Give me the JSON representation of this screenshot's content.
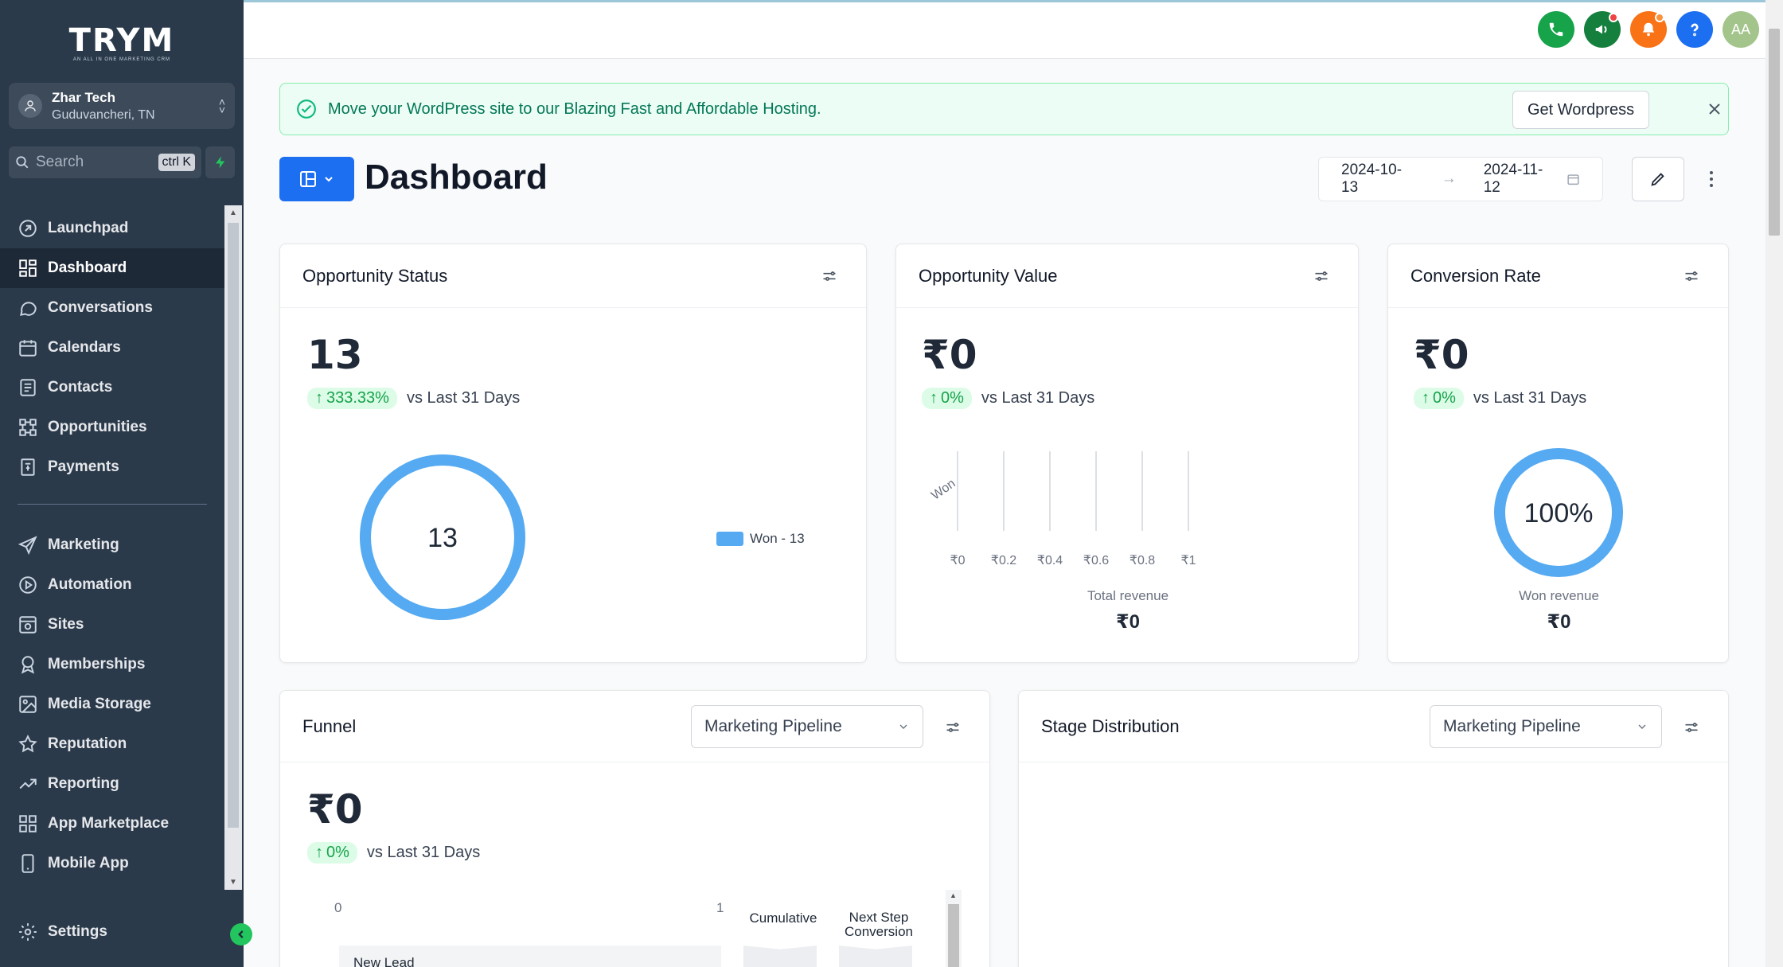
{
  "brand": {
    "logo": "TRYM",
    "tagline": "AN ALL IN ONE MARKETING CRM"
  },
  "account": {
    "name": "Zhar Tech",
    "location": "Guduvancheri, TN"
  },
  "search": {
    "placeholder": "Search",
    "shortcut": "ctrl K"
  },
  "nav": {
    "primary": [
      "Launchpad",
      "Dashboard",
      "Conversations",
      "Calendars",
      "Contacts",
      "Opportunities",
      "Payments"
    ],
    "secondary": [
      "Marketing",
      "Automation",
      "Sites",
      "Memberships",
      "Media Storage",
      "Reputation",
      "Reporting",
      "App Marketplace",
      "Mobile App"
    ],
    "settings": "Settings"
  },
  "topbar": {
    "avatar_initials": "AA"
  },
  "banner": {
    "text": "Move your WordPress site to our Blazing Fast and Affordable Hosting.",
    "button": "Get Wordpress"
  },
  "page": {
    "title": "Dashboard",
    "date_from": "2024-10-13",
    "date_to": "2024-11-12"
  },
  "cards": {
    "opportunity_status": {
      "title": "Opportunity Status",
      "value": "13",
      "change": "333.33%",
      "compare": "vs Last 31 Days",
      "donut_center": "13",
      "legend": "Won - 13",
      "chart_data": {
        "type": "pie",
        "categories": [
          "Won"
        ],
        "values": [
          13
        ]
      }
    },
    "opportunity_value": {
      "title": "Opportunity Value",
      "value": "₹0",
      "change": "0%",
      "compare": "vs Last 31 Days",
      "category_label": "Won",
      "x_ticks": [
        "₹0",
        "₹0.2",
        "₹0.4",
        "₹0.6",
        "₹0.8",
        "₹1"
      ],
      "total_label": "Total revenue",
      "total_value": "₹0",
      "chart_data": {
        "type": "bar",
        "categories": [
          "Won"
        ],
        "values": [
          0
        ],
        "xlim": [
          0,
          1
        ]
      }
    },
    "conversion_rate": {
      "title": "Conversion Rate",
      "value": "₹0",
      "change": "0%",
      "compare": "vs Last 31 Days",
      "ring_label": "100%",
      "won_label": "Won revenue",
      "won_value": "₹0",
      "chart_data": {
        "type": "pie",
        "categories": [
          "Won"
        ],
        "values": [
          100
        ]
      }
    },
    "funnel": {
      "title": "Funnel",
      "pipeline": "Marketing Pipeline",
      "value": "₹0",
      "change": "0%",
      "compare": "vs Last 31 Days",
      "axis_min": "0",
      "axis_max": "1",
      "col_cumulative": "Cumulative",
      "col_next": "Next Step Conversion",
      "stage": "New Lead"
    },
    "stage_distribution": {
      "title": "Stage Distribution",
      "pipeline": "Marketing Pipeline"
    }
  },
  "colors": {
    "accent": "#1d6ff2",
    "chart_blue": "#55aaf2",
    "success": "#16a34a",
    "sidebar": "#2b3a4a"
  }
}
